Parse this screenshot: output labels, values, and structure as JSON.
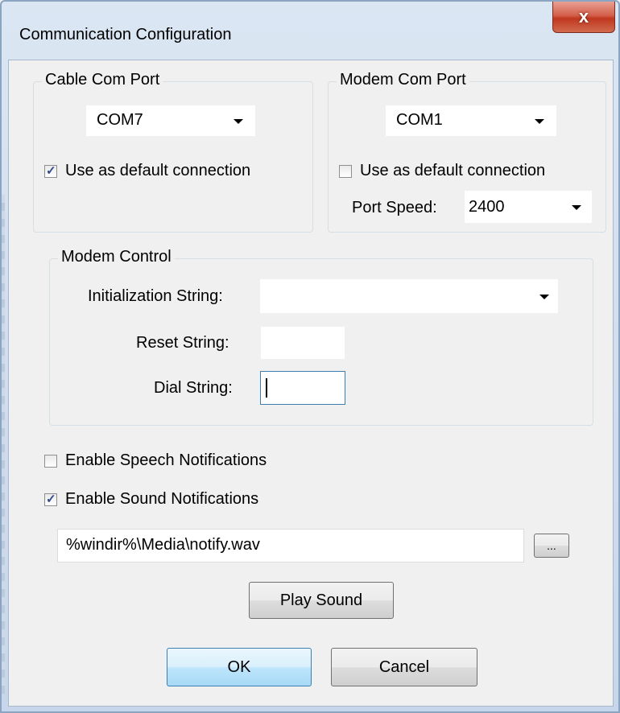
{
  "window": {
    "title": "Communication Configuration",
    "close_glyph": "x"
  },
  "cable": {
    "group_label": "Cable Com Port",
    "port_value": "COM7",
    "default_label": "Use as default connection",
    "default_checked": true
  },
  "modem_port": {
    "group_label": "Modem Com Port",
    "port_value": "COM1",
    "default_label": "Use as default connection",
    "default_checked": false,
    "speed_label": "Port Speed:",
    "speed_value": "2400"
  },
  "modem_control": {
    "group_label": "Modem Control",
    "init_label": "Initialization String:",
    "init_value": "",
    "reset_label": "Reset String:",
    "reset_value": "",
    "dial_label": "Dial String:",
    "dial_value": ""
  },
  "notifications": {
    "speech_label": "Enable Speech Notifications",
    "speech_checked": false,
    "sound_label": "Enable Sound Notifications",
    "sound_checked": true,
    "sound_path": "%windir%\\Media\\notify.wav",
    "browse_label": "...",
    "play_label": "Play Sound"
  },
  "buttons": {
    "ok": "OK",
    "cancel": "Cancel"
  },
  "check_glyph": "✓"
}
